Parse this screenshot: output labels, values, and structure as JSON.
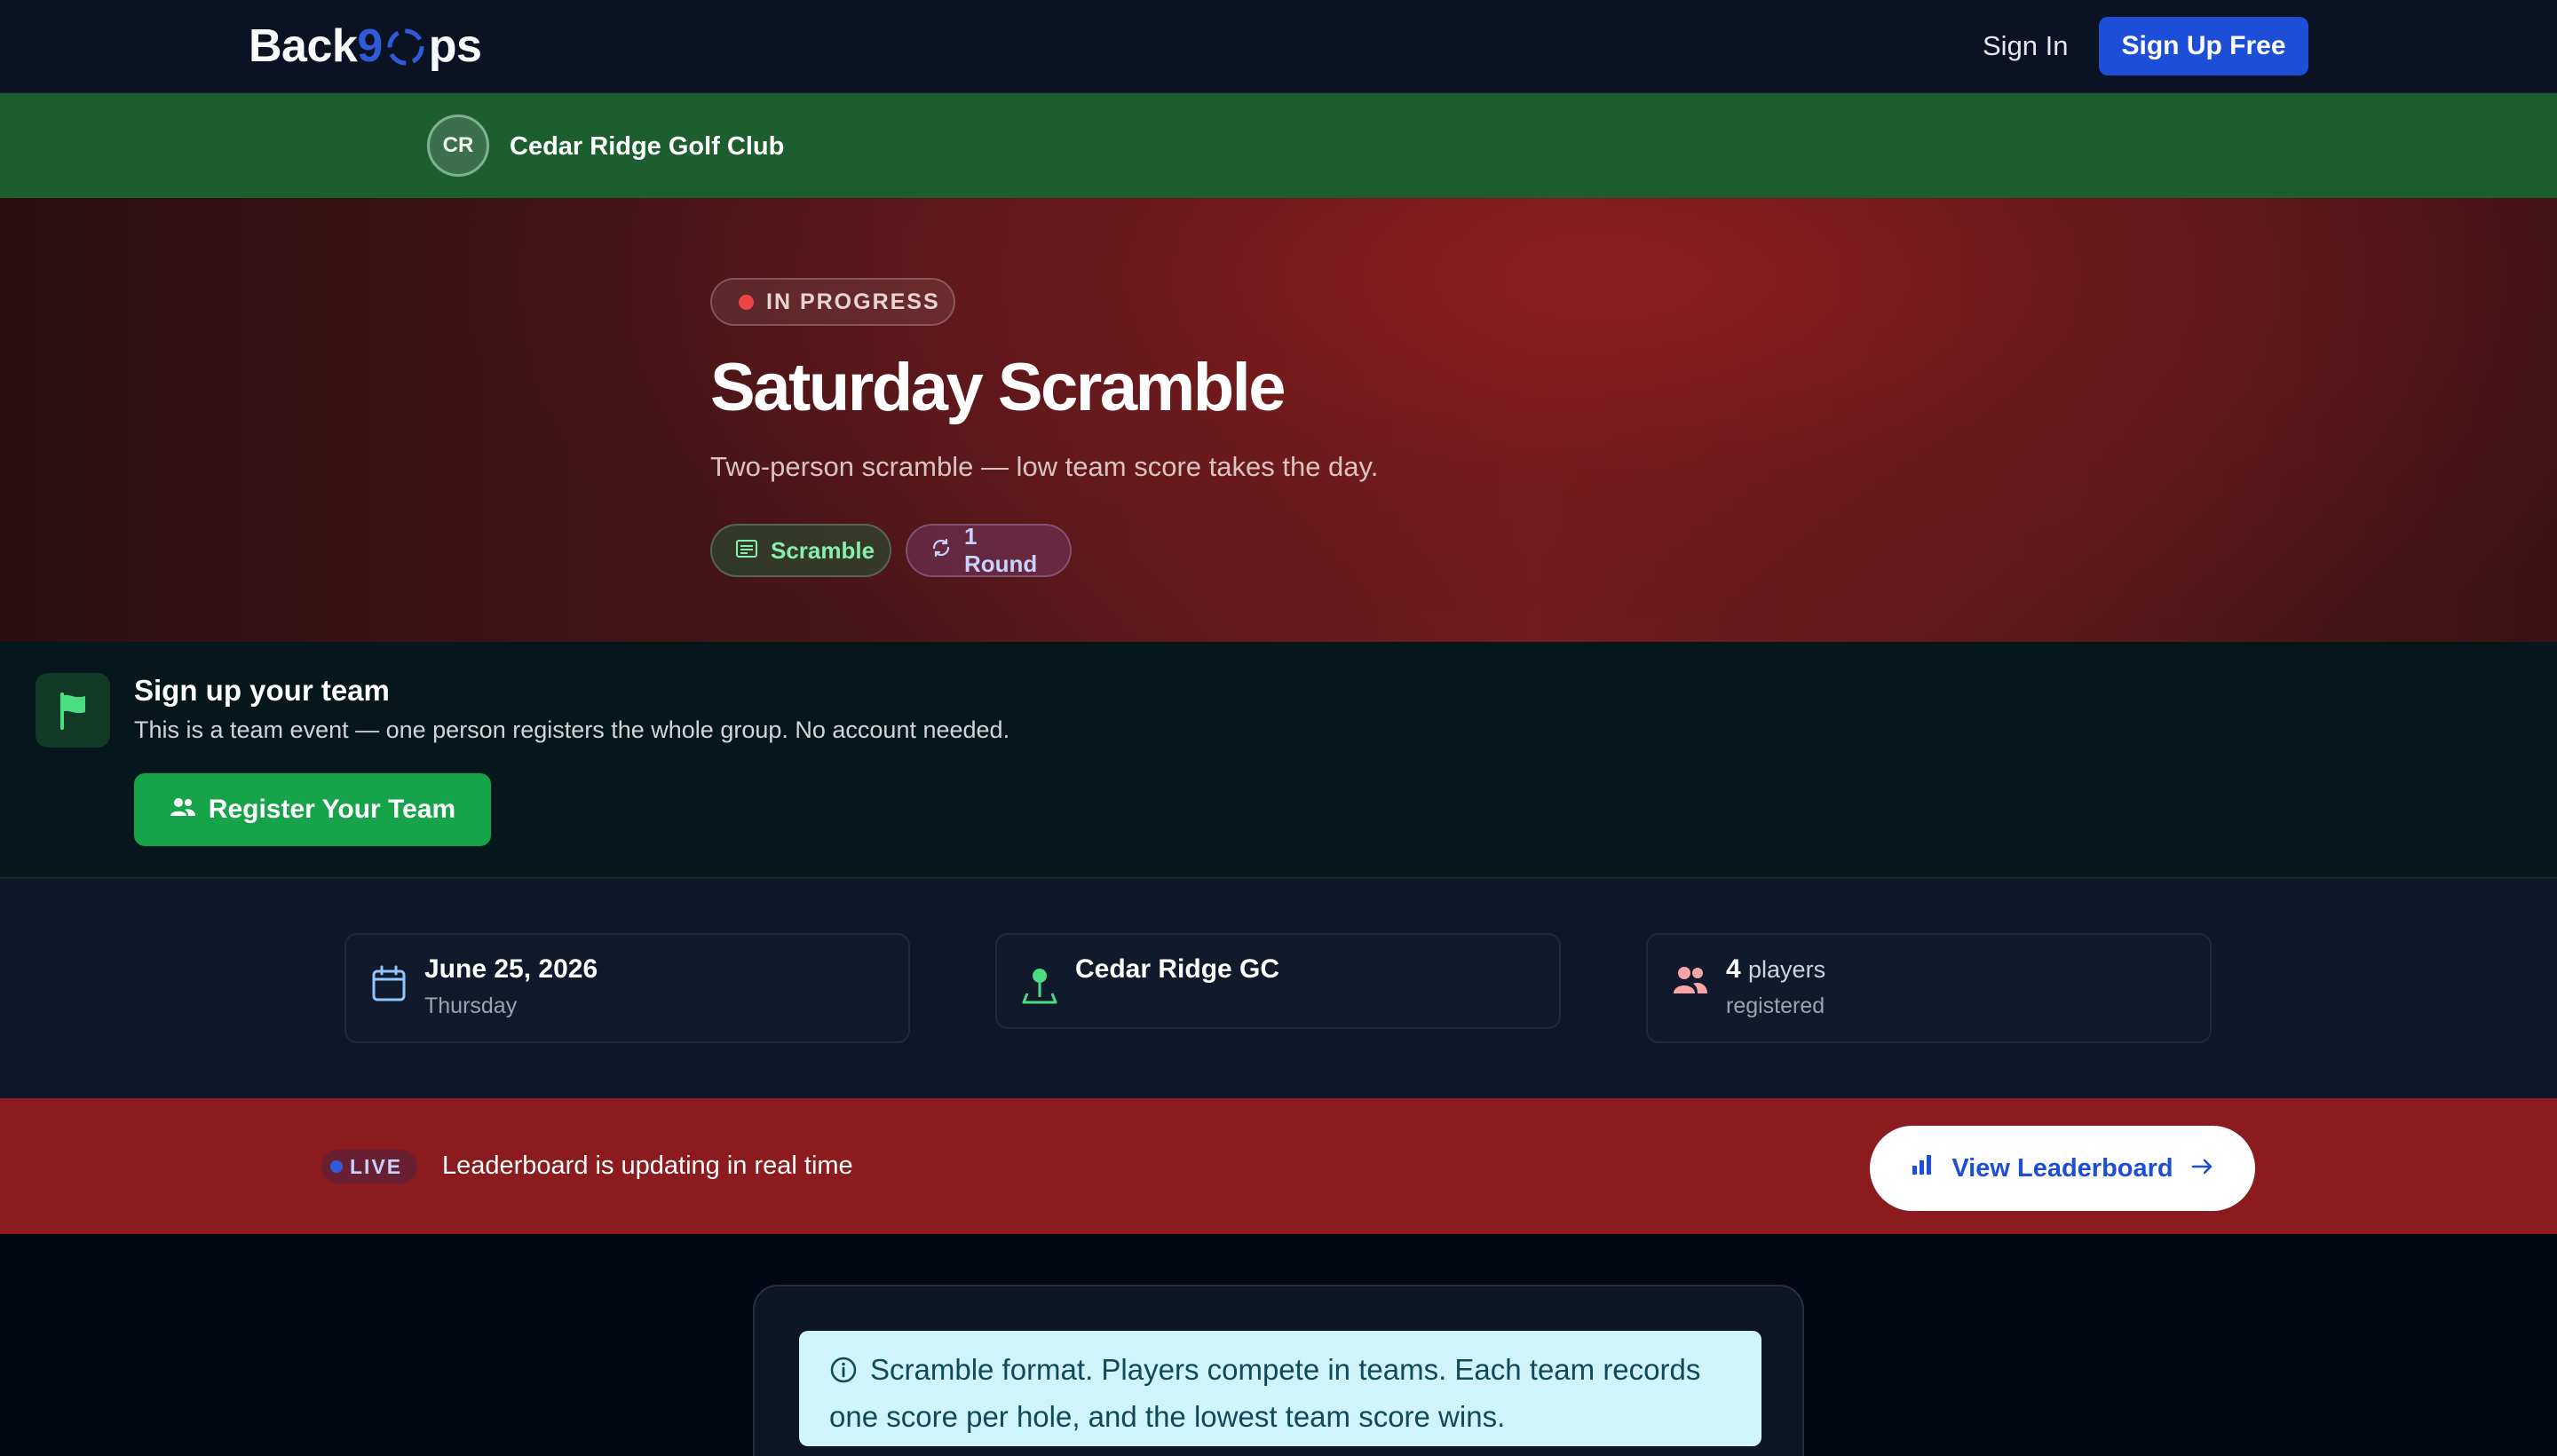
{
  "nav": {
    "logo_prefix": "Back",
    "logo_nine": "9",
    "logo_suffix": "ps",
    "signin_label": "Sign In",
    "signup_label": "Sign Up Free"
  },
  "club": {
    "initials": "CR",
    "name": "Cedar Ridge Golf Club"
  },
  "event": {
    "status": "IN PROGRESS",
    "title": "Saturday Scramble",
    "subtitle": "Two-person scramble — low team score takes the day.",
    "format_tag": "Scramble",
    "rounds_tag": "1 Round"
  },
  "signup": {
    "title": "Sign up your team",
    "description": "This is a team event — one person registers the whole group. No account needed.",
    "button_label": "Register Your Team"
  },
  "info": {
    "date": "June 25, 2026",
    "weekday": "Thursday",
    "location": "Cedar Ridge GC",
    "players_count": "4",
    "players_unit": "players",
    "players_sub": "registered"
  },
  "live": {
    "badge": "LIVE",
    "text": "Leaderboard is updating in real time",
    "button_label": "View Leaderboard"
  },
  "notice": {
    "text": "Scramble format. Players compete in teams. Each team records one score per hole, and the lowest team score wins."
  },
  "icons": {
    "logo_ring": "ring-icon",
    "format": "scorecard-icon",
    "rounds": "refresh-icon",
    "flag": "flag-icon",
    "team": "users-icon",
    "calendar": "calendar-icon",
    "location": "map-pin-icon",
    "players": "users-icon",
    "leaderboard": "bar-chart-icon",
    "arrow": "arrow-right-icon",
    "info": "info-icon"
  },
  "colors": {
    "brand_blue": "#1d4ed8",
    "club_green": "#1d5e2e",
    "hero_red": "#7a1d1f",
    "live_red": "#8b1b1e",
    "register_green": "#16a34a",
    "status_dot": "#ef4444",
    "notice_bg": "#cff4fc"
  }
}
